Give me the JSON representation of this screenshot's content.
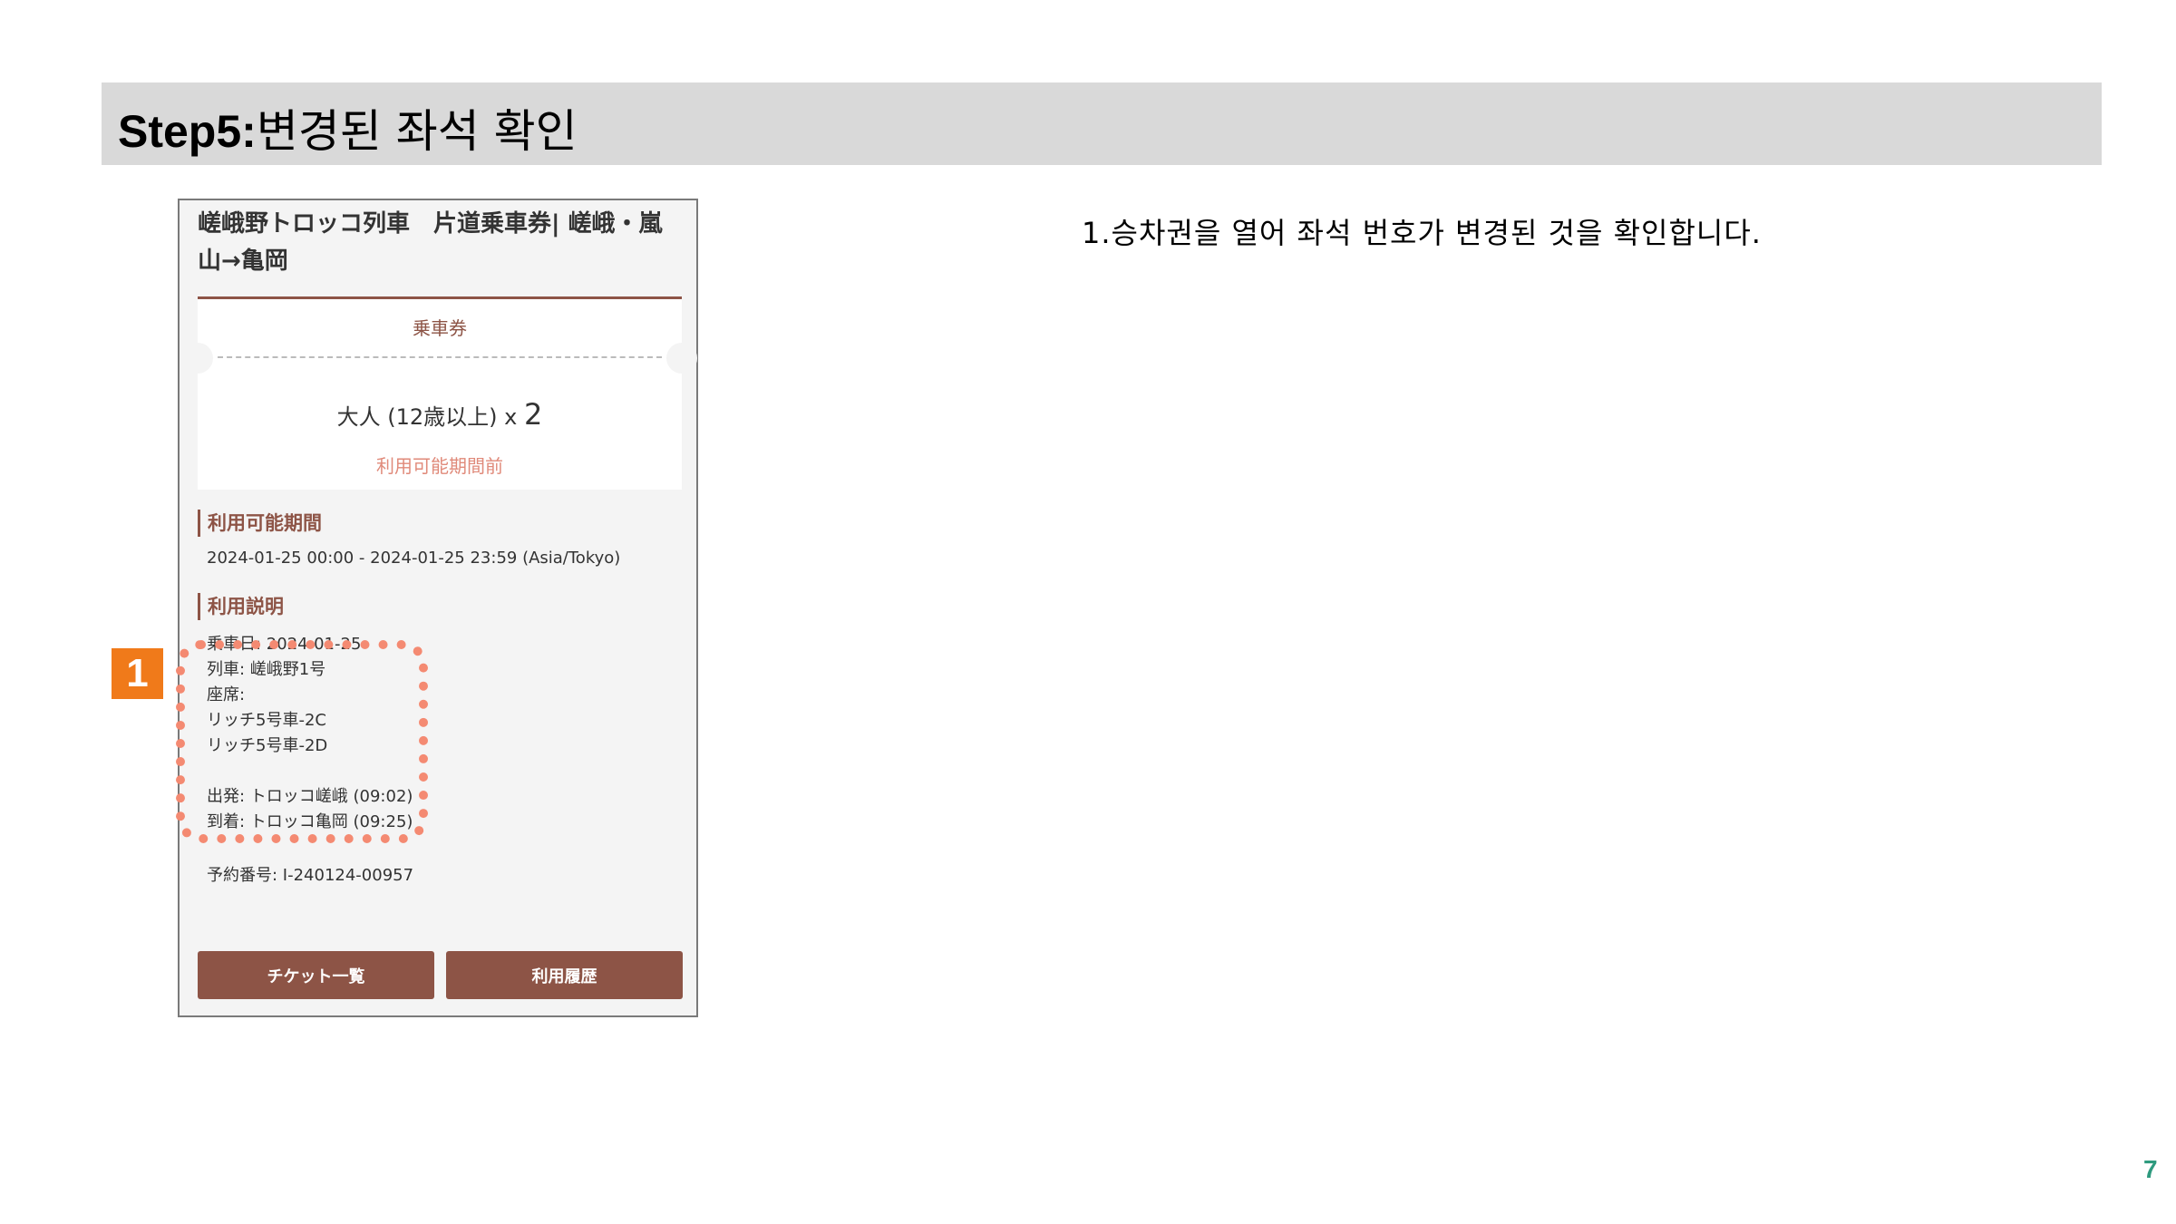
{
  "slide": {
    "title_step": "Step5:",
    "title_text": "변경된 좌석 확인",
    "instruction": "1.승차권을 열어 좌석 번호가 변경된 것을 확인합니다.",
    "badge": "1",
    "page_number": "7",
    "highlight_color": "#f48a72",
    "badge_color": "#f07a1a"
  },
  "ticket": {
    "title": "嵯峨野トロッコ列車　片道乗車券| 嵯峨・嵐山→亀岡",
    "card_label": "乗車券",
    "passenger": "大人 (12歳以上) x",
    "passenger_count": "2",
    "status": "利用可能期間前",
    "period_heading": "利用可能期間",
    "period_value": "2024-01-25 00:00 - 2024-01-25 23:59 (Asia/Tokyo)",
    "desc_heading": "利用説明",
    "desc_lines": [
      "乗車日: 2024-01-25",
      "列車: 嵯峨野1号",
      "座席:",
      "リッチ5号車-2C",
      "リッチ5号車-2D",
      "",
      "出発: トロッコ嵯峨 (09:02)",
      "到着: トロッコ亀岡 (09:25)"
    ],
    "reservation": "予約番号: I-240124-00957",
    "buttons": [
      "チケット一覧",
      "利用履歴"
    ],
    "accent_color": "#8d5446"
  }
}
